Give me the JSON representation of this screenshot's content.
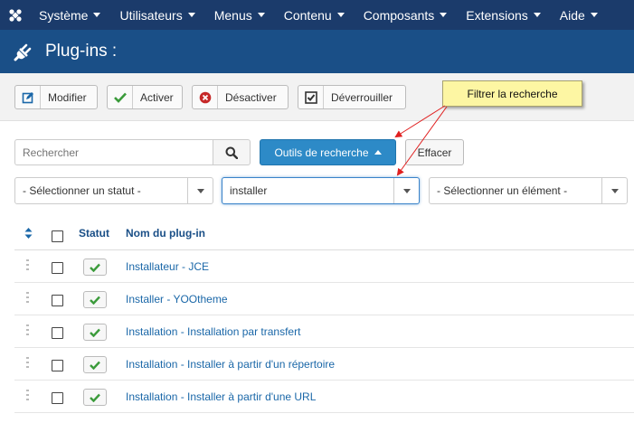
{
  "topnav": {
    "items": [
      {
        "label": "Système"
      },
      {
        "label": "Utilisateurs"
      },
      {
        "label": "Menus"
      },
      {
        "label": "Contenu"
      },
      {
        "label": "Composants"
      },
      {
        "label": "Extensions"
      },
      {
        "label": "Aide"
      }
    ]
  },
  "header": {
    "title": "Plug-ins :"
  },
  "toolbar": {
    "edit_label": "Modifier",
    "enable_label": "Activer",
    "disable_label": "Désactiver",
    "unlock_label": "Déverrouiller"
  },
  "search": {
    "placeholder": "Rechercher",
    "tools_label": "Outils de recherche",
    "clear_label": "Effacer"
  },
  "filters": {
    "status": "- Sélectionner un statut -",
    "type": "installer",
    "element": "- Sélectionner un élément -"
  },
  "table": {
    "col_status": "Statut",
    "col_name": "Nom du plug-in",
    "rows": [
      {
        "name": "Installateur - JCE"
      },
      {
        "name": "Installer - YOOtheme"
      },
      {
        "name": "Installation - Installation par transfert"
      },
      {
        "name": "Installation - Installer à partir d'un répertoire"
      },
      {
        "name": "Installation - Installer à partir d'une URL"
      }
    ]
  },
  "annotation": {
    "text": "Filtrer la recherche"
  },
  "colors": {
    "nav_bg": "#1b3b6b",
    "title_bg": "#1a4f87",
    "primary": "#2d8ac7",
    "link": "#1a67a8",
    "success": "#3b9b3b",
    "danger": "#c62828",
    "tooltip_bg": "#fdf6a3",
    "annotation_arrow": "#e02020"
  },
  "icons": {
    "logo": "joomla-icon",
    "title": "plug-icon",
    "edit": "edit-icon",
    "enable": "check-icon",
    "disable": "cancel-icon",
    "unlock": "checkin-icon",
    "search": "search-icon",
    "sort": "sort-icon"
  }
}
